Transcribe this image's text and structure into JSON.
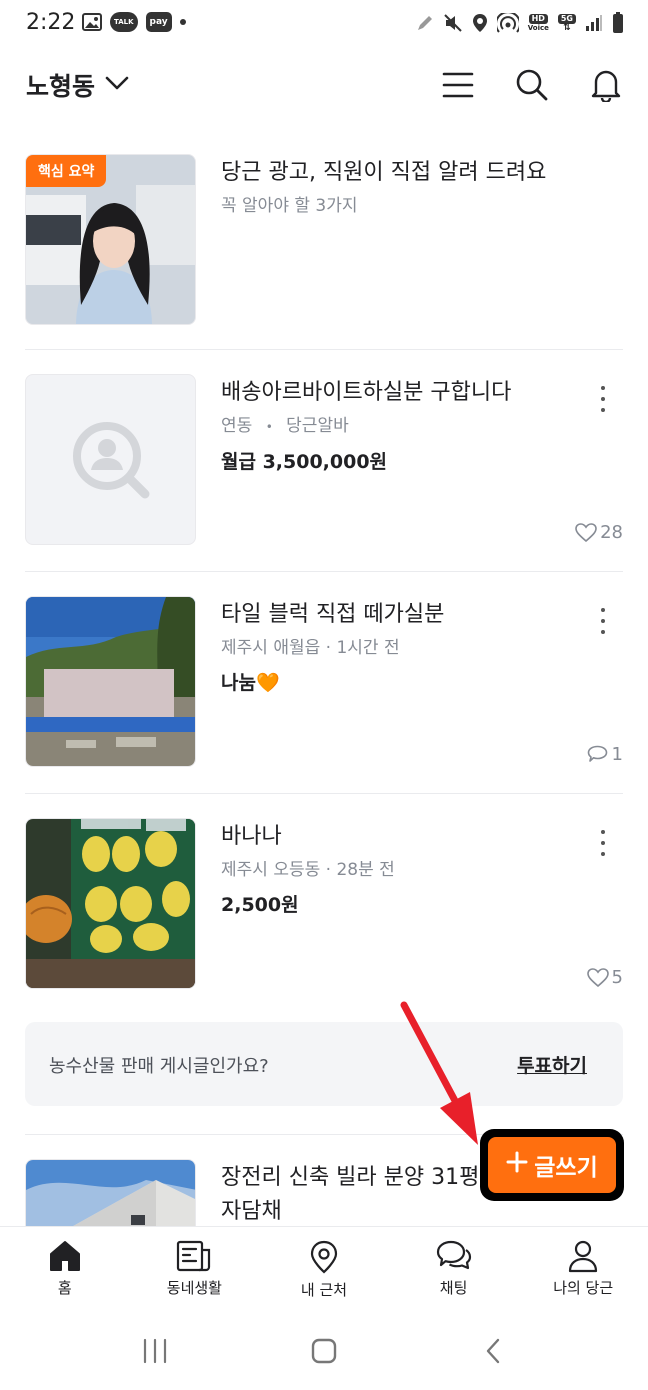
{
  "status_bar": {
    "time": "2:22",
    "talk_label": "TALK",
    "pay_label": "pay",
    "hd_label": "HD",
    "voice_label": "Voice",
    "network_label": "5G"
  },
  "header": {
    "location": "노형동"
  },
  "feed": {
    "items": [
      {
        "badge": "핵심 요약",
        "title": "당근 광고, 직원이 직접 알려 드려요",
        "subtitle": "꼭 알아야 할 3가지"
      },
      {
        "title": "배송아르바이트하실분 구합니다",
        "location": "연동",
        "separator": "•",
        "category": "당근알바",
        "price": "월급 3,500,000원",
        "likes": "28"
      },
      {
        "title": "타일 블럭 직접 떼가실분",
        "subtitle": "제주시 애월읍 · 1시간 전",
        "price": "나눔🧡",
        "comments": "1"
      },
      {
        "title": "바나나",
        "subtitle": "제주시 오등동 · 28분 전",
        "price": "2,500원",
        "likes": "5"
      }
    ],
    "vote_banner": {
      "text": "농수산물 판매 게시글인가요?",
      "button": "투표하기"
    },
    "last_item": {
      "title": "장전리 신축 빌라 분양 31평 자담채"
    }
  },
  "write_button": {
    "label": "글쓰기"
  },
  "bottom_nav": {
    "items": [
      {
        "label": "홈"
      },
      {
        "label": "동네생활"
      },
      {
        "label": "내 근처"
      },
      {
        "label": "채팅"
      },
      {
        "label": "나의 당근"
      }
    ]
  },
  "colors": {
    "accent": "#ff6f0f",
    "annotation_arrow": "#e8202a"
  }
}
